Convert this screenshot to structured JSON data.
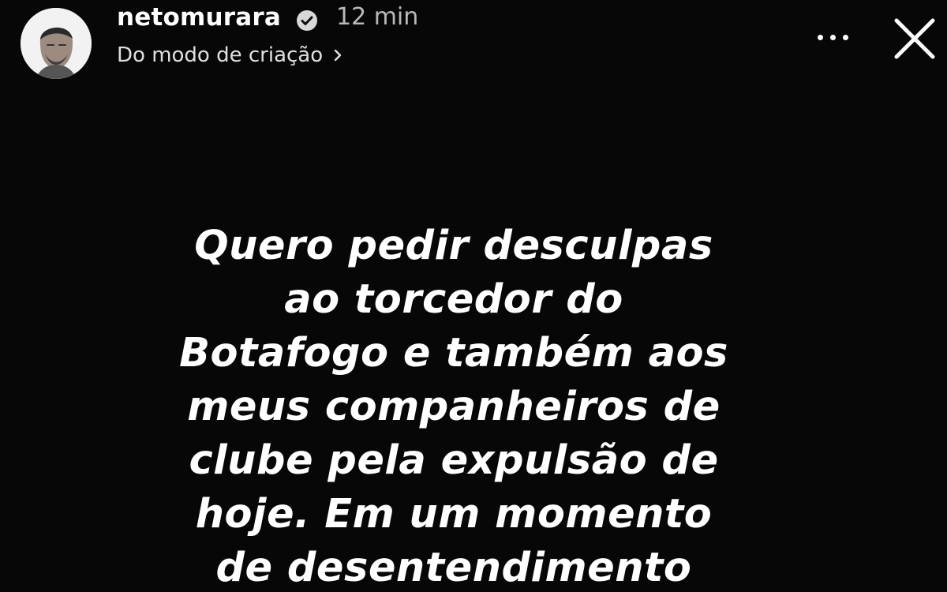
{
  "header": {
    "username": "netomurara",
    "verified_icon": "verified-badge-icon",
    "timestamp": "12 min",
    "subtitle": "Do modo de criação",
    "subtitle_icon": "chevron-right-icon",
    "menu_icon": "more-options-icon",
    "close_icon": "close-icon"
  },
  "story": {
    "lines": [
      "Quero pedir desculpas",
      "ao torcedor do",
      "Botafogo e também aos",
      "meus companheiros de",
      "clube pela expulsão de",
      "hoje. Em um momento",
      "de desentendimento"
    ]
  },
  "colors": {
    "background": "#070707",
    "text": "#ffffff"
  }
}
